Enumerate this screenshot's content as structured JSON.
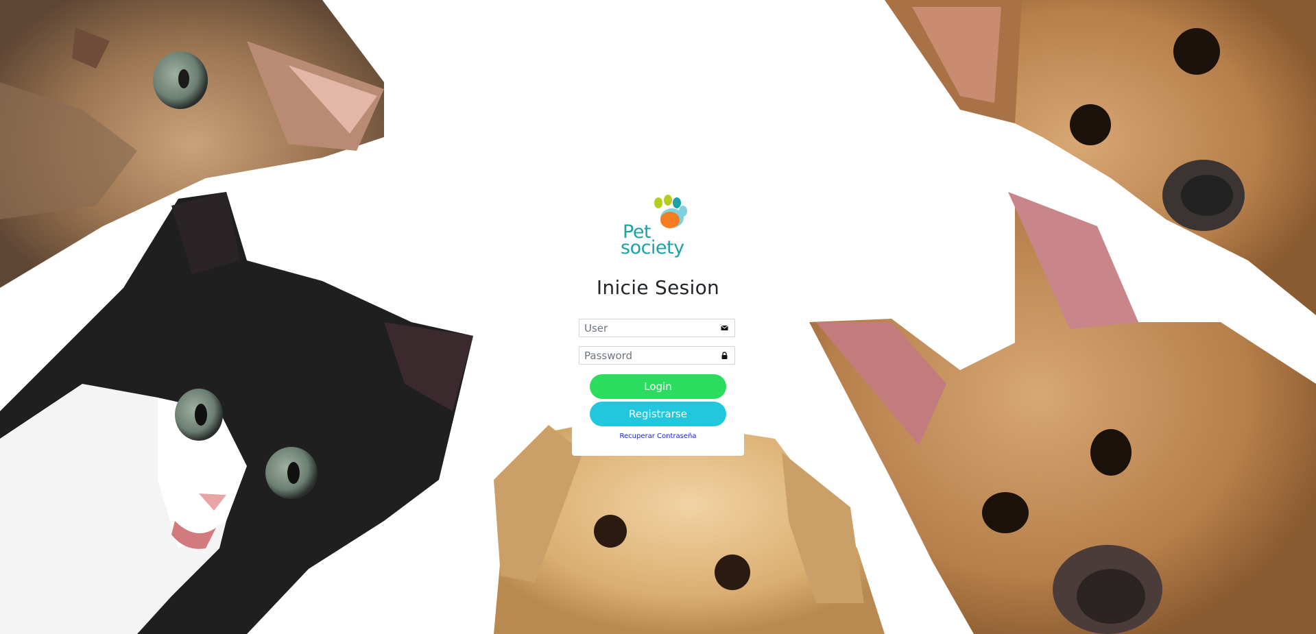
{
  "brand": {
    "logo_line_1": "Pet",
    "logo_line_2": "society",
    "logo_color": "#1aa3a6",
    "paw_colors": [
      "#b6cc1e",
      "#1aa3a6",
      "#7fd0e0",
      "#f47d20"
    ]
  },
  "login": {
    "title": "Inicie Sesion",
    "user_placeholder": "User",
    "user_value": "",
    "user_icon": "envelope-icon",
    "password_placeholder": "Password",
    "password_value": "",
    "password_icon": "lock-icon",
    "login_label": "Login",
    "register_label": "Registrarse",
    "recover_label": "Recuperar Contraseña"
  },
  "colors": {
    "login_button": "#2bdc5e",
    "register_button": "#22c7de",
    "link": "#1a22d6"
  },
  "background": {
    "description_icon": "cats-and-dogs-photo"
  }
}
